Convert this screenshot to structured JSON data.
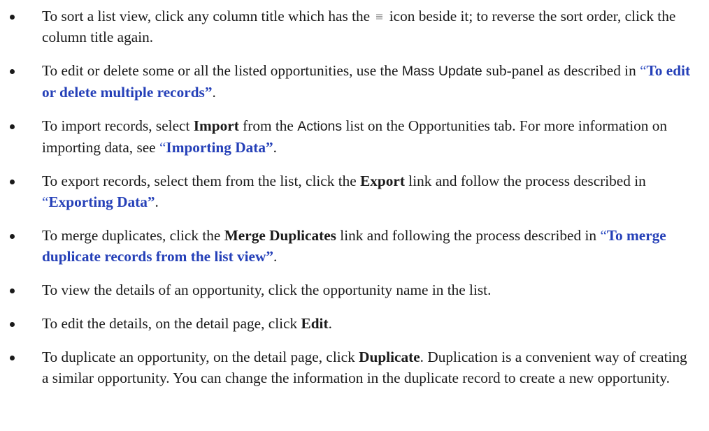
{
  "bullets": [
    {
      "before": "To sort a list view, click any column title which has the",
      "icon": "sort-icon",
      "after": "icon beside it; to reverse the sort order, click the column title again."
    },
    {
      "before": "To edit or delete some or all the listed opportunities, use the ",
      "ui": "Mass Update",
      "middle": " sub-panel as described in ",
      "link": "To edit or delete multiple records",
      "end": "."
    },
    {
      "before": "To import records, select ",
      "bold": "Import",
      "middle": " from the ",
      "ui": "Actions",
      "middle2": " list on the Opportunities tab. For more information on importing data, see ",
      "link": "Importing Data",
      "end": "."
    },
    {
      "before": "To export records, select them from the list, click the ",
      "bold": "Export",
      "middle": " link and follow the process described in ",
      "link": "Exporting Data",
      "end": "."
    },
    {
      "before": "To merge duplicates, click the ",
      "bold": "Merge Duplicates",
      "middle": " link and following the process described in ",
      "link": "To merge duplicate records from the list view",
      "end": "."
    },
    {
      "before": "To view the details of an opportunity, click the opportunity name in the list."
    },
    {
      "before": "To edit the details, on the detail page, click ",
      "bold": "Edit",
      "end": "."
    },
    {
      "before": "To duplicate an opportunity, on the detail page, click ",
      "bold": "Duplicate",
      "end": ". Duplication is a convenient way of creating a similar opportunity. You can change the information in the duplicate record to create a new opportunity."
    }
  ],
  "quote_open": "“",
  "quote_close": "”",
  "colors": {
    "link": "#2540b8",
    "quote": "#3352c4",
    "text": "#1a1a1a",
    "bullet": "#1a1a1a"
  }
}
